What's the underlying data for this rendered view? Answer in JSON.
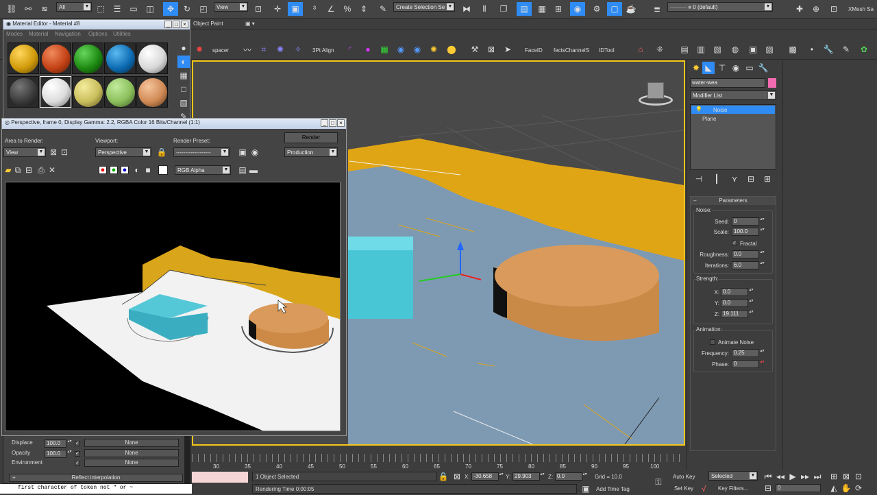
{
  "toolbar": {
    "filter_value": "All",
    "view_value": "View",
    "selection_set_placeholder": "Create Selection Se",
    "layer_value": "0 (default)",
    "app_label": "XMesh Sa"
  },
  "ribbon": {
    "tab_object_paint": "Object Paint",
    "spacer_label": "spacer",
    "align_label": "3Pt Align",
    "faceid_label": "FaceID",
    "effects_label": "fectsChannelS",
    "idtool_label": "IDTool"
  },
  "material_editor": {
    "title": "Material Editor - Material #8",
    "menu": [
      "Modes",
      "Material",
      "Navigation",
      "Options",
      "Utilities"
    ],
    "maps": [
      {
        "name": "Displace",
        "amount": "100.0",
        "map": "None"
      },
      {
        "name": "Opacity",
        "amount": "100.0",
        "map": "None"
      },
      {
        "name": "Environment",
        "amount": "",
        "map": "None"
      }
    ],
    "reflect_interp": "Reflect interpolation"
  },
  "render_window": {
    "title": "Perspective, frame 0, Display Gamma: 2.2, RGBA Color 16 Bits/Channel (1:1)",
    "area_label": "Area to Render:",
    "area_value": "View",
    "viewport_label": "Viewport:",
    "viewport_value": "Perspective",
    "preset_label": "Render Preset:",
    "preset_value": "-------------------",
    "render_button": "Render",
    "production_value": "Production",
    "channel_value": "RGB Alpha"
  },
  "command_panel": {
    "object_name": "water-wea",
    "modifier_list_label": "Modifier List",
    "stack": [
      {
        "label": "Noise",
        "selected": true
      },
      {
        "label": "Plane",
        "selected": false
      }
    ],
    "rollout_title": "Parameters",
    "noise_group": "Noise:",
    "seed_label": "Seed:",
    "seed_value": "0",
    "scale_label": "Scale:",
    "scale_value": "100.0",
    "fractal_label": "Fractal",
    "roughness_label": "Roughness:",
    "roughness_value": "0.0",
    "iterations_label": "Iterations:",
    "iterations_value": "6.0",
    "strength_group": "Strength:",
    "x_label": "X:",
    "x_value": "0.0",
    "y_label": "Y:",
    "y_value": "0.0",
    "z_label": "Z:",
    "z_value": "19.111",
    "animation_group": "Animation:",
    "animate_noise_label": "Animate Noise",
    "frequency_label": "Frequency:",
    "frequency_value": "0.25",
    "phase_label": "Phase:",
    "phase_value": "0"
  },
  "timeline": {
    "ticks": [
      "30",
      "35",
      "40",
      "45",
      "50",
      "55",
      "60",
      "65",
      "70",
      "75",
      "80",
      "85",
      "90",
      "95",
      "100"
    ]
  },
  "status": {
    "maxscript_text": "first character of token not \" or ~",
    "selection_text": "1 Object Selected",
    "rendering_time": "Rendering Time  0:00:05",
    "x_label": "X:",
    "x_value": "-30.658",
    "y_label": "Y:",
    "y_value": "29.903",
    "z_label": "Z:",
    "z_value": "0.0",
    "grid": "Grid = 10.0",
    "add_time_tag": "Add Time Tag",
    "auto_key": "Auto Key",
    "selected_value": "Selected",
    "set_key": "Set Key",
    "key_filters": "Key Filters...",
    "frame_value": "0"
  },
  "colors": {
    "ui_dark": "#3d3d3d",
    "viewport_border": "#f5c518",
    "selection_blue": "#2f8cf5",
    "water": "#7e9ab3",
    "orange_plane": "#e0a515",
    "box_cyan": "#49c6d6",
    "cylinder": "#d99a5b"
  }
}
